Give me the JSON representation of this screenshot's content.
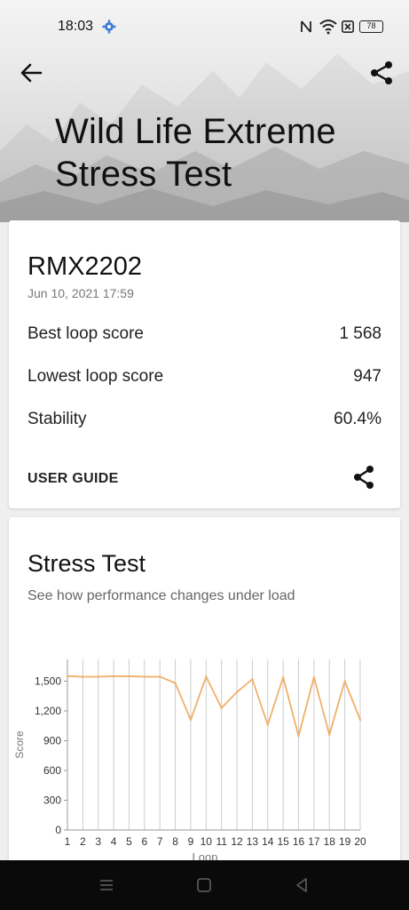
{
  "status_bar": {
    "time": "18:03",
    "battery": "78"
  },
  "header": {
    "title_line1": "Wild Life Extreme",
    "title_line2": "Stress Test"
  },
  "summary": {
    "device": "RMX2202",
    "date": "Jun 10, 2021 17:59",
    "rows": [
      {
        "label": "Best loop score",
        "value": "1 568"
      },
      {
        "label": "Lowest loop score",
        "value": "947"
      },
      {
        "label": "Stability",
        "value": "60.4%"
      }
    ],
    "user_guide": "USER GUIDE"
  },
  "stress": {
    "title": "Stress Test",
    "subtitle": "See how performance changes under load"
  },
  "colors": {
    "line": "#f0b06a",
    "grid": "#cccccc"
  },
  "chart_data": {
    "type": "line",
    "xlabel": "Loop",
    "ylabel": "Score",
    "ylim": [
      0,
      1700
    ],
    "yticks": [
      0,
      300,
      600,
      900,
      1200,
      1500
    ],
    "ytick_labels": [
      "0",
      "300",
      "600",
      "900",
      "1,200",
      "1,500"
    ],
    "x": [
      1,
      2,
      3,
      4,
      5,
      6,
      7,
      8,
      9,
      10,
      11,
      12,
      13,
      14,
      15,
      16,
      17,
      18,
      19,
      20
    ],
    "series": [
      {
        "values": [
          1551,
          1545,
          1545,
          1550,
          1550,
          1545,
          1545,
          1480,
          1110,
          1545,
          1230,
          1390,
          1520,
          1060,
          1540,
          947,
          1540,
          960,
          1500,
          1110
        ]
      }
    ],
    "grid": true
  }
}
